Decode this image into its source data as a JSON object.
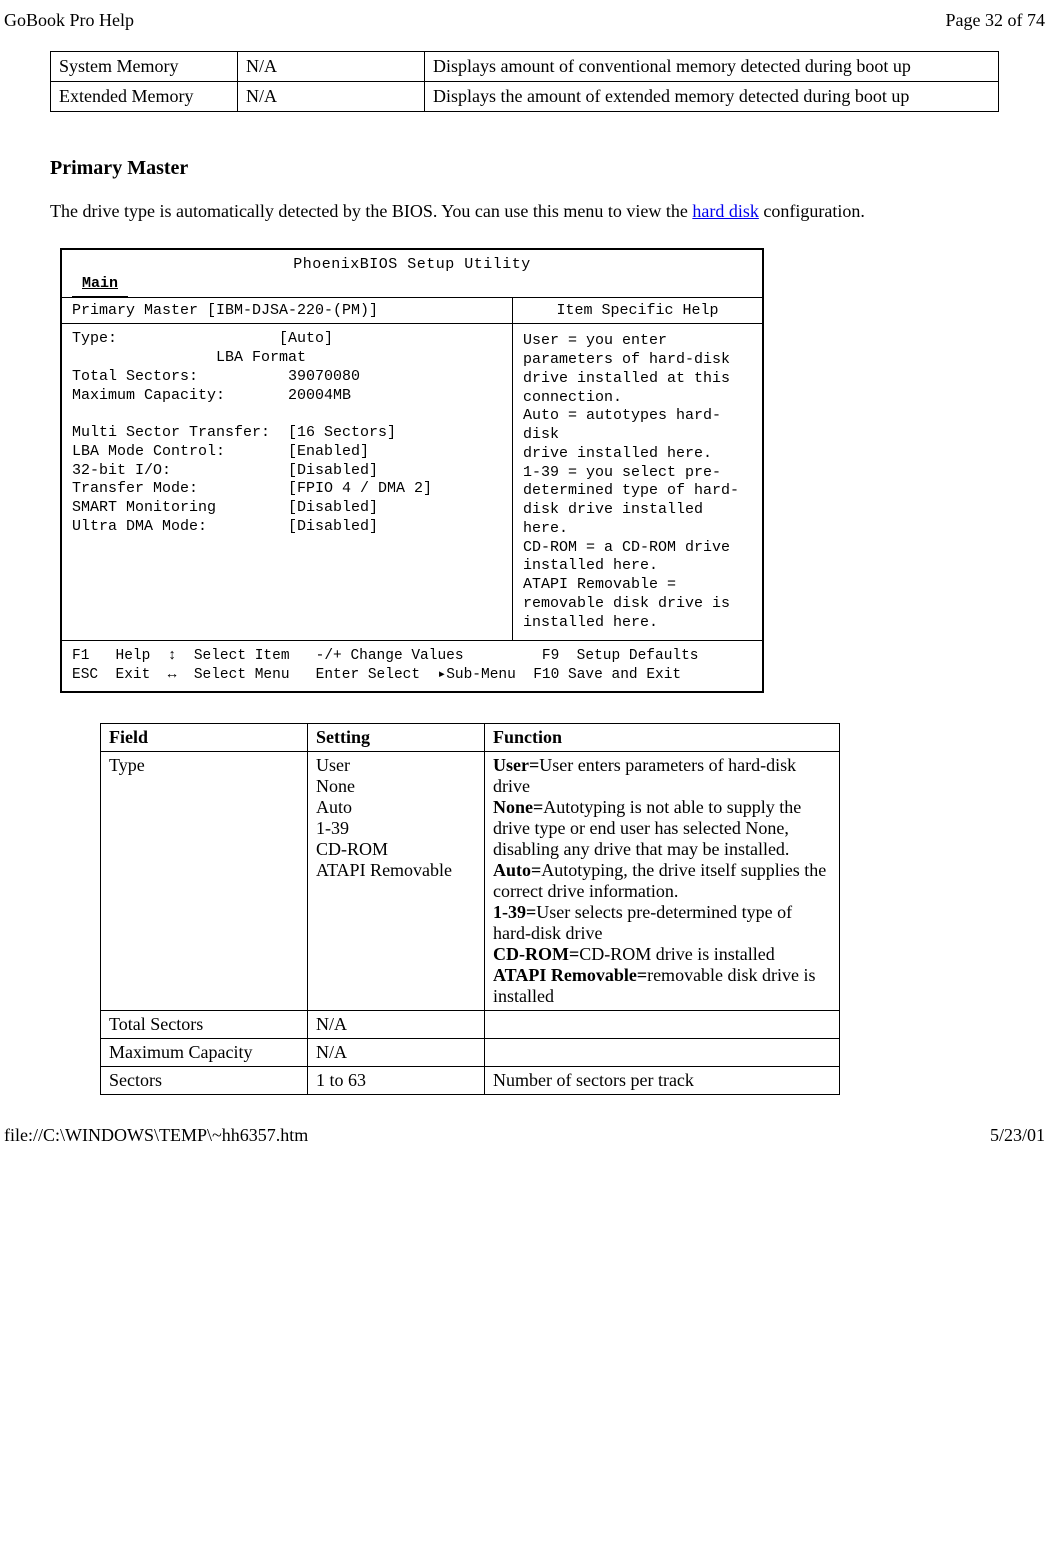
{
  "header": {
    "left": "GoBook Pro Help",
    "right": "Page 32 of 74"
  },
  "topTable": {
    "rows": [
      {
        "c1": "System Memory",
        "c2": "N/A",
        "c3": "Displays amount of conventional memory detected during boot up"
      },
      {
        "c1": "Extended Memory",
        "c2": "N/A",
        "c3": "Displays the amount of extended memory detected during boot up"
      }
    ]
  },
  "section": {
    "heading": "Primary Master",
    "intro_before": "The drive type is automatically detected by the BIOS.  You can use this menu to view the ",
    "intro_link": "hard disk",
    "intro_after": " configuration."
  },
  "bios": {
    "title": "PhoenixBIOS Setup Utility",
    "tab": "Main",
    "header_left": "Primary Master [IBM-DJSA-220-(PM)]",
    "header_right": "Item Specific Help",
    "left_block": "Type:                  [Auto]\n                LBA Format\nTotal Sectors:          39070080\nMaximum Capacity:       20004MB\n\nMulti Sector Transfer:  [16 Sectors]\nLBA Mode Control:       [Enabled]\n32-bit I/O:             [Disabled]\nTransfer Mode:          [FPIO 4 / DMA 2]\nSMART Monitoring        [Disabled]\nUltra DMA Mode:         [Disabled]",
    "right_block": "User = you enter\nparameters of hard-disk\ndrive installed at this\nconnection.\nAuto = autotypes hard-disk\ndrive installed here.\n1-39 = you select pre-\ndetermined type of hard-\ndisk drive installed here.\nCD-ROM = a CD-ROM drive\ninstalled here.\nATAPI Removable =\nremovable disk drive is\ninstalled here.",
    "footer": "F1   Help  ↕  Select Item   -/+ Change Values         F9  Setup Defaults\nESC  Exit  ↔  Select Menu   Enter Select  ▸Sub-Menu  F10 Save and Exit"
  },
  "fieldsTable": {
    "headers": {
      "h1": "Field",
      "h2": "Setting",
      "h3": "Function"
    },
    "rows": [
      {
        "field": "Type",
        "setting": "User\nNone\nAuto\n1-39\nCD-ROM\nATAPI Removable",
        "functionParts": [
          {
            "b": "User=",
            "t": "User enters parameters of hard-disk drive"
          },
          {
            "b": "None=",
            "t": "Autotyping is not able to supply the drive type or end user has selected None, disabling any drive that may be installed."
          },
          {
            "b": "Auto=",
            "t": "Autotyping, the drive itself supplies the correct drive information."
          },
          {
            "b": "1-39=",
            "t": "User selects pre-determined type of hard-disk drive"
          },
          {
            "b": "CD-ROM=",
            "t": "CD-ROM drive is installed"
          },
          {
            "b": "ATAPI Removable=",
            "t": "removable disk drive is installed"
          }
        ]
      },
      {
        "field": "Total Sectors",
        "setting": "N/A",
        "functionText": ""
      },
      {
        "field": "Maximum Capacity",
        "setting": "N/A",
        "functionText": ""
      },
      {
        "field": "Sectors",
        "setting": "1 to 63",
        "functionText": " Number of sectors per track"
      }
    ]
  },
  "footer": {
    "left": "file://C:\\WINDOWS\\TEMP\\~hh6357.htm",
    "right": "5/23/01"
  }
}
